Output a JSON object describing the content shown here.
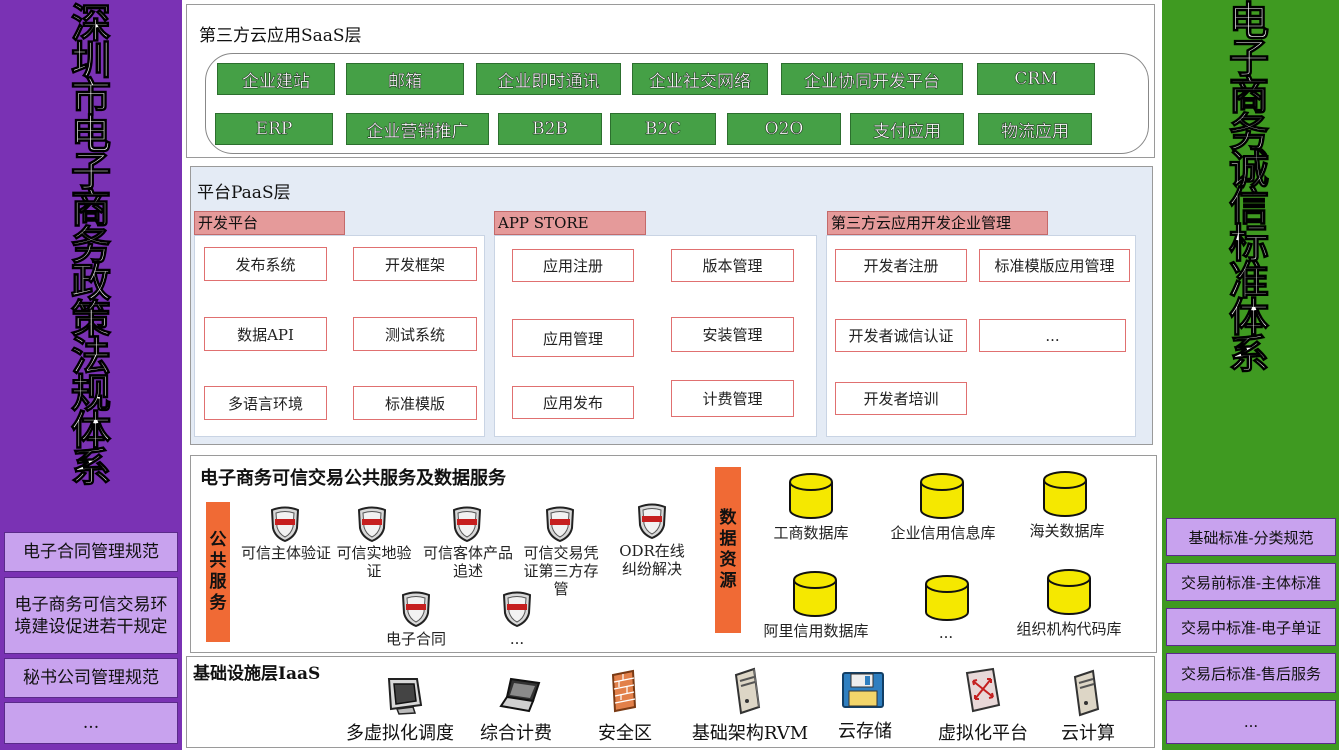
{
  "left_column": {
    "title": "深圳市电子商务政策法规体系",
    "items": [
      "电子合同管理规范",
      "电子商务可信交易环境建设促进若干规定",
      "秘书公司管理规范",
      "..."
    ]
  },
  "right_column": {
    "title": "电子商务诚信标准体系",
    "items": [
      "基础标准-分类规范",
      "交易前标准-主体标准",
      "交易中标准-电子单证",
      "交易后标准-售后服务",
      "..."
    ]
  },
  "saas": {
    "title": "第三方云应用SaaS层",
    "row1": [
      "企业建站",
      "邮箱",
      "企业即时通讯",
      "企业社交网络",
      "企业协同开发平台",
      "CRM"
    ],
    "row2": [
      "ERP",
      "企业营销推广",
      "B2B",
      "B2C",
      "O2O",
      "支付应用",
      "物流应用"
    ]
  },
  "paas": {
    "title": "平台PaaS层",
    "dev": {
      "title": "开发平台",
      "items": [
        "发布系统",
        "开发框架",
        "数据API",
        "测试系统",
        "多语言环境",
        "标准模版"
      ]
    },
    "store": {
      "title": "APP STORE",
      "items": [
        "应用注册",
        "版本管理",
        "应用管理",
        "安装管理",
        "应用发布",
        "计费管理"
      ]
    },
    "third": {
      "title": "第三方云应用开发企业管理",
      "items": [
        "开发者注册",
        "标准模版应用管理",
        "开发者诚信认证",
        "...",
        "开发者培训"
      ]
    }
  },
  "services": {
    "title": "电子商务可信交易公共服务及数据服务",
    "public_label": "公共服务",
    "public_items": [
      "可信主体验证",
      "可信实地验证",
      "可信客体产品追述",
      "可信交易凭证第三方存管",
      "ODR在线纠纷解决",
      "电子合同",
      "..."
    ],
    "data_label": "数据资源",
    "databases": [
      "工商数据库",
      "企业信用信息库",
      "海关数据库",
      "阿里信用数据库",
      "...",
      "组织机构代码库"
    ]
  },
  "iaas": {
    "title": "基础设施层IaaS",
    "items": [
      {
        "label": "多虚拟化调度",
        "icon": "monitor-icon"
      },
      {
        "label": "综合计费",
        "icon": "laptop-icon"
      },
      {
        "label": "安全区",
        "icon": "firewall-icon"
      },
      {
        "label": "基础架构RVM",
        "icon": "server-icon"
      },
      {
        "label": "云存储",
        "icon": "floppy-icon"
      },
      {
        "label": "虚拟化平台",
        "icon": "switch-icon"
      },
      {
        "label": "云计算",
        "icon": "server-icon"
      }
    ]
  },
  "colors": {
    "purple": "#7a32b4",
    "light_purple": "#c8a2ee",
    "green": "#3f9a21",
    "button_green": "#45a046",
    "orange": "#f06a35",
    "tab_red": "#e59a9a",
    "db_yellow": "#f5e800"
  }
}
